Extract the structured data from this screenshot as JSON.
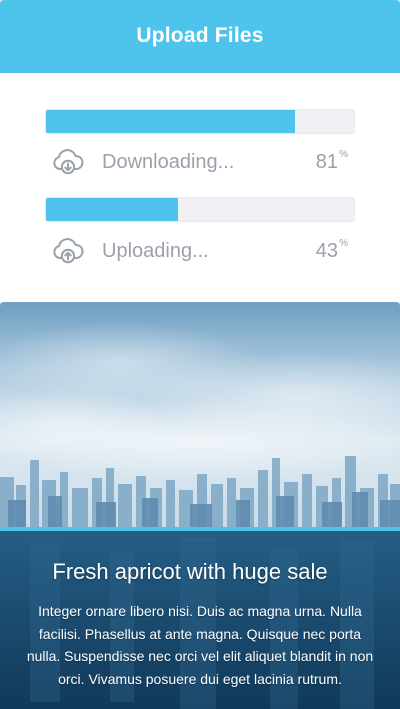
{
  "header": {
    "title": "Upload Files",
    "color": "#4ec3ec"
  },
  "transfers": [
    {
      "label": "Downloading...",
      "icon": "cloud-download-icon",
      "progress": 81,
      "percent_value": "81",
      "percent_sign": "%"
    },
    {
      "label": "Uploading...",
      "icon": "cloud-upload-icon",
      "progress": 43,
      "percent_value": "43",
      "percent_sign": "%"
    }
  ],
  "promo": {
    "image": "city-skyline-photo",
    "heading": "Fresh apricot with huge sale",
    "body": "Integer ornare libero nisi. Duis ac magna urna. Nulla facilisi. Phasellus at ante magna. Quisque nec porta nulla. Suspendisse nec orci vel elit aliquet blandit in non orci. Vivamus posuere dui eget lacinia rutrum."
  },
  "colors": {
    "accent": "#4ec3ec",
    "track": "#f1f1f5",
    "muted_text": "#9aa1ab"
  }
}
